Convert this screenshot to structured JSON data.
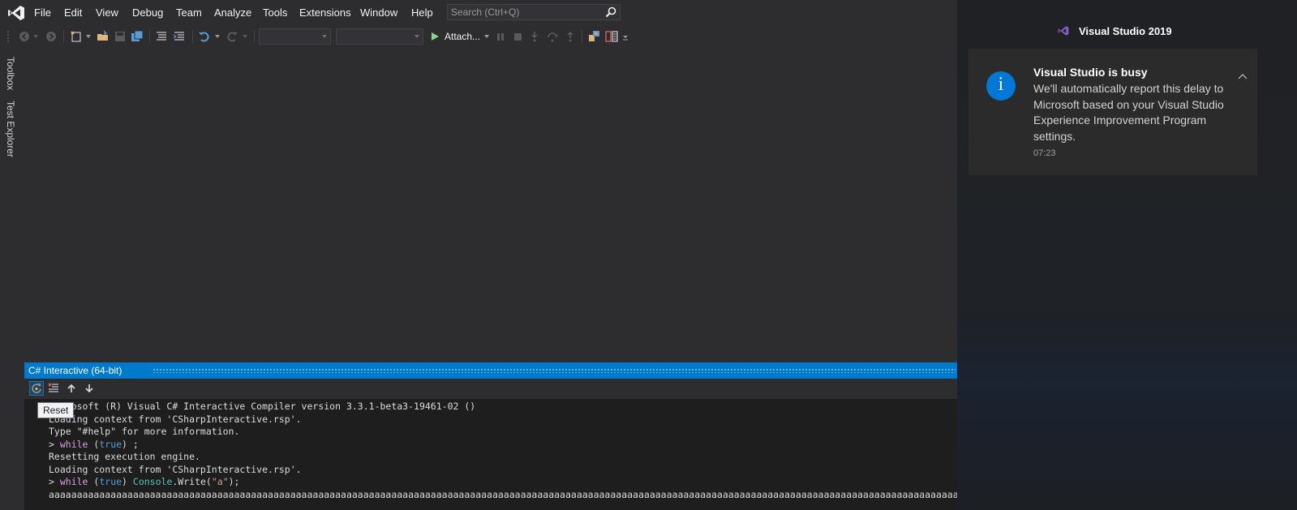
{
  "menu": {
    "items": [
      "File",
      "Edit",
      "View",
      "Debug",
      "Team",
      "Analyze",
      "Tools",
      "Extensions",
      "Window",
      "Help"
    ]
  },
  "search": {
    "placeholder": "Search (Ctrl+Q)"
  },
  "toolbar": {
    "attach_label": "Attach...",
    "config_combo": "",
    "platform_combo": ""
  },
  "side_tabs": [
    "Toolbox",
    "Test Explorer"
  ],
  "interactive": {
    "title": "C# Interactive (64-bit)",
    "tooltip": "Reset",
    "lines": [
      "Microsoft (R) Visual C# Interactive Compiler version 3.3.1-beta3-19461-02 ()",
      "Loading context from 'CSharpInteractive.rsp'.",
      "Type \"#help\" for more information.",
      "> while (true) ;",
      "Resetting execution engine.",
      "Loading context from 'CSharpInteractive.rsp'.",
      "> while (true) Console.Write(\"a\");",
      "aaaaaaaaaaaaaaaaaaaaaaaaaaaaaaaaaaaaaaaaaaaaaaaaaaaaaaaaaaaaaaaaaaaaaaaaaaaaaaaaaaaaaaaaaaaaaaaaaaaaaaaaaaaaaaaaaaaaaaaaaaaaaaaaaaaaaaaaaaaaaaaaaaaaaaaaaaaaaaaaaaaaaaaaaaaaaaaaaaaaa"
    ],
    "code_tokens": {
      "prompt": "> ",
      "while": "while",
      "open": " (",
      "true": "true",
      "close_semi": ") ;",
      "close": ") ",
      "console": "Console",
      "dot_write": ".Write(",
      "string_a": "\"a\"",
      "end": ");"
    }
  },
  "notification": {
    "app_name": "Visual Studio 2019",
    "title": "Visual Studio is busy",
    "body": "We'll automatically report this delay to Microsoft based on your Visual Studio Experience Improvement Program settings.",
    "time": "07:23",
    "icon": "info-icon"
  },
  "colors": {
    "accent": "#007acc",
    "vs_purple": "#865fc5",
    "notify_icon": "#0078d7"
  }
}
